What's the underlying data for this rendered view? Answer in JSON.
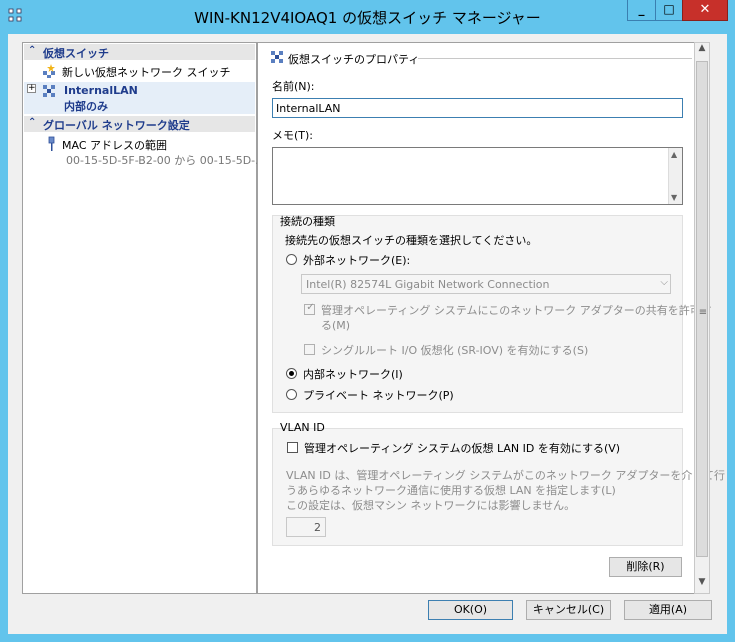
{
  "window": {
    "title": "WIN-KN12V4IOAQ1 の仮想スイッチ マネージャー",
    "controls": {
      "minimize": "_",
      "maximize": "□",
      "close": "✕"
    }
  },
  "tree": {
    "section_switches": "仮想スイッチ",
    "new_switch": "新しい仮想ネットワーク スイッチ",
    "switch_name": "InternalLAN",
    "switch_type": "内部のみ",
    "section_global": "グローバル ネットワーク設定",
    "mac_range_title": "MAC アドレスの範囲",
    "mac_range_value": "00-15-5D-5F-B2-00 から 00-15-5D-..."
  },
  "properties": {
    "header": "仮想スイッチのプロパティ",
    "name_label": "名前(N):",
    "name_value": "InternalLAN",
    "notes_label": "メモ(T):",
    "notes_value": "",
    "conn_type_label": "接続の種類",
    "conn_type_desc": "接続先の仮想スイッチの種類を選択してください。",
    "external_label": "外部ネットワーク(E):",
    "adapter_value": "Intel(R) 82574L Gigabit Network Connection",
    "allow_mgmt_line1": "管理オペレーティング システムにこのネットワーク アダプターの共有を許可す",
    "allow_mgmt_line2": "る(M)",
    "sriov_label": "シングルルート I/O 仮想化 (SR-IOV) を有効にする(S)",
    "internal_label": "内部ネットワーク(I)",
    "private_label": "プライベート ネットワーク(P)",
    "selected_connection": "internal",
    "vlan_title": "VLAN ID",
    "vlan_enable_label": "管理オペレーティング システムの仮想 LAN ID を有効にする(V)",
    "vlan_desc_line1": "VLAN ID は、管理オペレーティング システムがこのネットワーク アダプターを介して行",
    "vlan_desc_line2": "うあらゆるネットワーク通信に使用する仮想 LAN を指定します(L)",
    "vlan_desc_line3": "この設定は、仮想マシン ネットワークには影響しません。",
    "vlan_value": "2",
    "remove_button": "削除(R)"
  },
  "buttons": {
    "ok": "OK(O)",
    "cancel": "キャンセル(C)",
    "apply": "適用(A)"
  },
  "colors": {
    "titlebar": "#62c4ec",
    "close_button": "#c7302a",
    "tree_section_text": "#1f3c8c",
    "focus_border": "#3c7fb1"
  }
}
